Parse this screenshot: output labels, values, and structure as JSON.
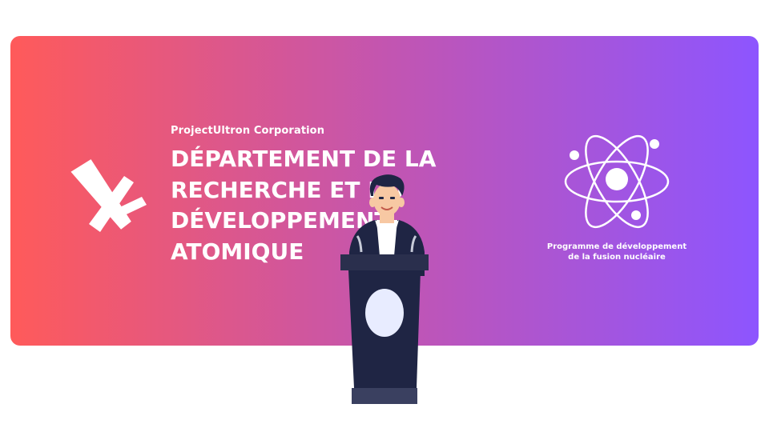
{
  "company": "ProjectUltron Corporation",
  "title_lines": [
    "DÉPARTEMENT DE LA",
    "RECHERCHE ET DU",
    "DÉVELOPPEMENT",
    "ATOMIQUE"
  ],
  "program": {
    "line1": "Programme de développement",
    "line2": "de la fusion nucléaire"
  },
  "icons": {
    "logo": "stylized-a-logo",
    "atom": "atom-icon",
    "speaker": "speaker-at-podium-illustration"
  },
  "colors": {
    "gradient_start": "#ff5a5a",
    "gradient_mid": "#c355b0",
    "gradient_end": "#8d55ff",
    "text": "#ffffff",
    "podium": "#1f2544",
    "podium_top": "#2a2f4d",
    "podium_base": "#3a4060",
    "podium_emblem": "#e8ecff"
  }
}
